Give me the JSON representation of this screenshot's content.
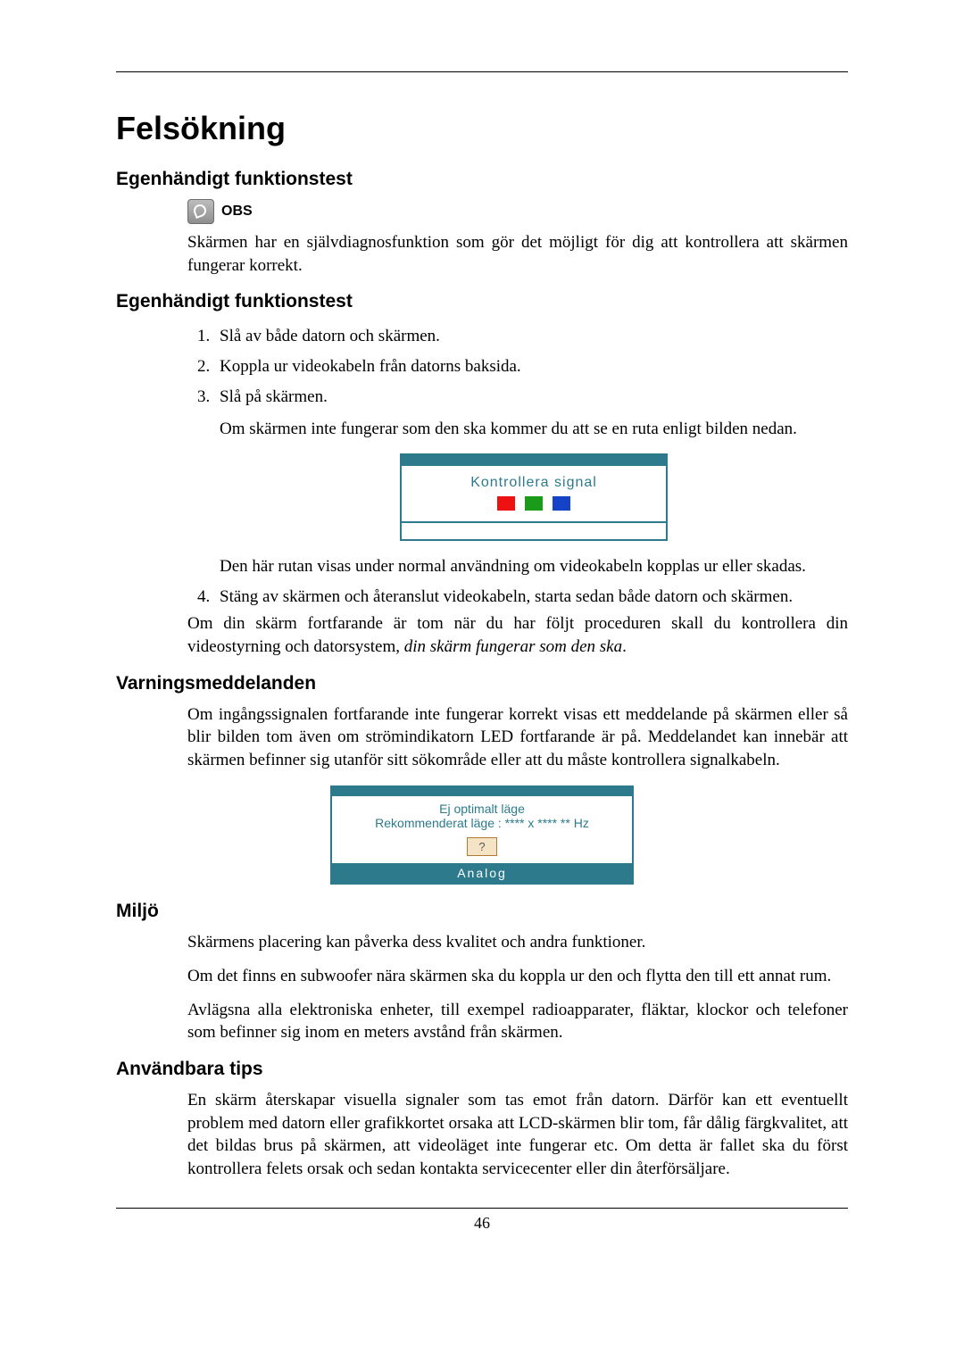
{
  "page_number": "46",
  "title": "Felsökning",
  "sections": {
    "s1": {
      "heading": "Egenhändigt funktionstest",
      "obs_label": "OBS",
      "p1": "Skärmen har en självdiagnosfunktion som gör det möjligt för dig att kontrollera att skärmen fungerar korrekt."
    },
    "s2": {
      "heading": "Egenhändigt funktionstest",
      "steps": {
        "i1": "Slå av både datorn och skärmen.",
        "i2": "Koppla ur videokabeln från datorns baksida.",
        "i3": "Slå på skärmen.",
        "i3_p": "Om skärmen inte fungerar som den ska kommer du att se en ruta enligt bilden nedan.",
        "dlg_title": "Kontrollera signal",
        "i3_p2": "Den här rutan visas under normal användning om videokabeln kopplas ur eller skadas.",
        "i4": "Stäng av skärmen och återanslut videokabeln, starta sedan både datorn och skärmen."
      },
      "after_a": "Om din skärm fortfarande är tom när du har följt proceduren skall du kontrollera din videostyrning och datorsystem, ",
      "after_b": "din skärm fungerar som den ska",
      "after_c": "."
    },
    "s3": {
      "heading": "Varningsmeddelanden",
      "p1": "Om ingångssignalen fortfarande inte fungerar korrekt visas ett meddelande på skärmen eller så blir bilden tom även om strömindikatorn LED fortfarande är på. Meddelandet kan innebär att skärmen befinner sig utanför sitt sökområde eller att du måste kontrollera signalkabeln.",
      "dlg_l1": "Ej optimalt läge",
      "dlg_l2": "Rekommenderat läge :  **** x ****  ** Hz",
      "dlg_btn": "?",
      "dlg_foot": "Analog"
    },
    "s4": {
      "heading": "Miljö",
      "p1": "Skärmens placering kan påverka dess kvalitet och andra funktioner.",
      "p2": "Om det finns en subwoofer nära skärmen ska du koppla ur den och flytta den till ett annat rum.",
      "p3": "Avlägsna alla elektroniska enheter, till exempel radioapparater, fläktar, klockor och telefoner som befinner sig inom en meters avstånd från skärmen."
    },
    "s5": {
      "heading": "Användbara tips",
      "p1": "En skärm återskapar visuella signaler som tas emot från datorn. Därför kan ett eventuellt problem med datorn eller grafikkortet orsaka att LCD-skärmen blir tom, får dålig färgkvalitet, att det bildas brus på skärmen, att videoläget inte fungerar etc. Om detta är fallet ska du först kontrollera felets orsak och sedan kontakta servicecenter eller din återförsäljare."
    }
  }
}
